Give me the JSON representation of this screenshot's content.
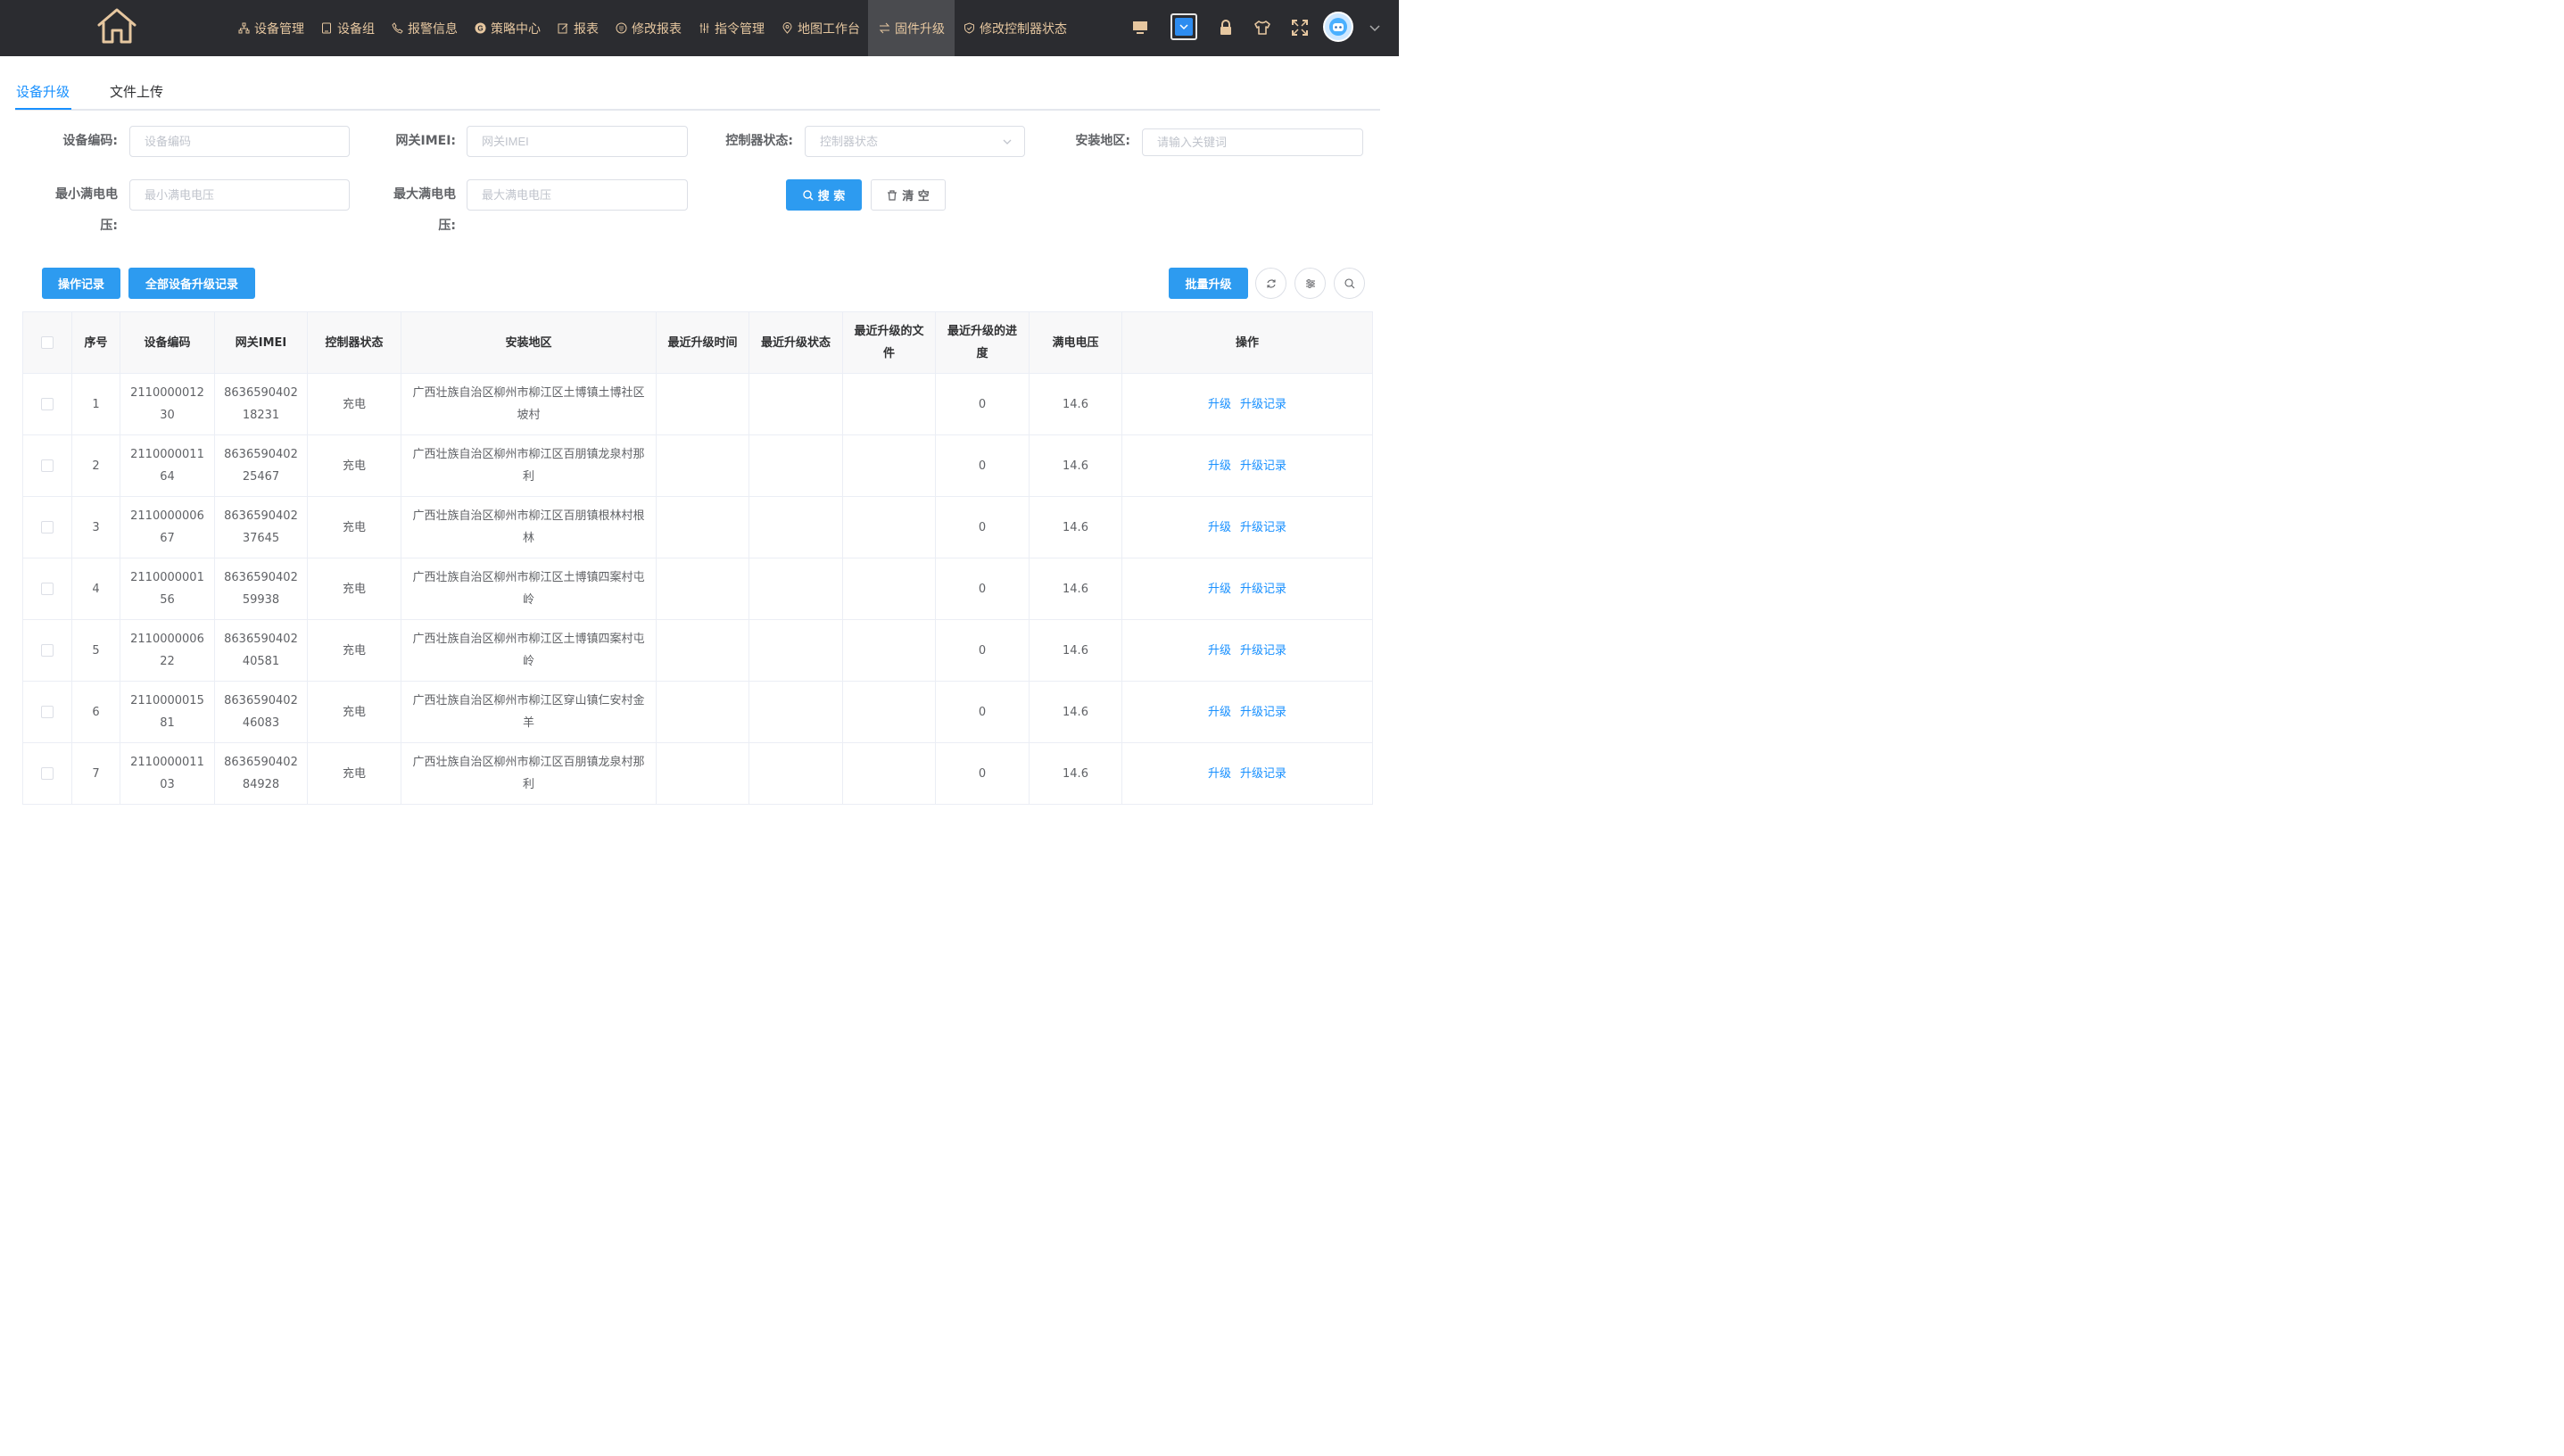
{
  "nav": {
    "items": [
      {
        "label": "设备管理",
        "icon": "sitemap-icon"
      },
      {
        "label": "设备组",
        "icon": "tablet-icon"
      },
      {
        "label": "报警信息",
        "icon": "phone-icon"
      },
      {
        "label": "策略中心",
        "icon": "strategy-icon"
      },
      {
        "label": "报表",
        "icon": "edit-icon"
      },
      {
        "label": "修改报表",
        "icon": "keyboard-icon"
      },
      {
        "label": "指令管理",
        "icon": "sliders-icon"
      },
      {
        "label": "地图工作台",
        "icon": "location-icon"
      },
      {
        "label": "固件升级",
        "icon": "switch-icon",
        "active": true
      },
      {
        "label": "修改控制器状态",
        "icon": "shield-icon"
      }
    ]
  },
  "tabs": [
    {
      "label": "设备升级",
      "active": true
    },
    {
      "label": "文件上传",
      "active": false
    }
  ],
  "filters": {
    "device_code": {
      "label": "设备编码:",
      "placeholder": "设备编码"
    },
    "gateway_imei": {
      "label": "网关IMEI:",
      "placeholder": "网关IMEI"
    },
    "controller_status": {
      "label": "控制器状态:",
      "placeholder": "控制器状态"
    },
    "install_area": {
      "label": "安装地区:",
      "placeholder": "请输入关键词"
    },
    "min_voltage": {
      "label_line1": "最小满电电",
      "label_line2": "压:",
      "placeholder": "最小满电电压"
    },
    "max_voltage": {
      "label_line1": "最大满电电",
      "label_line2": "压:",
      "placeholder": "最大满电电压"
    },
    "search_label": "搜 索",
    "clear_label": "清 空"
  },
  "toolbar": {
    "op_records": "操作记录",
    "all_upgrade_records": "全部设备升级记录",
    "batch_upgrade": "批量升级"
  },
  "table": {
    "headers": [
      "序号",
      "设备编码",
      "网关IMEI",
      "控制器状态",
      "安装地区",
      "最近升级时间",
      "最近升级状态",
      "最近升级的文件",
      "最近升级的进度",
      "满电电压",
      "操作"
    ],
    "upgrade_label": "升级",
    "records_label": "升级记录",
    "rows": [
      {
        "index": "1",
        "code": "211000001230",
        "imei": "863659040218231",
        "status": "充电",
        "area": "广西壮族自治区柳州市柳江区土博镇土博社区坡村",
        "time": "",
        "upstatus": "",
        "file": "",
        "progress": "0",
        "voltage": "14.6"
      },
      {
        "index": "2",
        "code": "2110000011 64",
        "imei": "863659040225467",
        "status": "充电",
        "area": "广西壮族自治区柳州市柳江区百朋镇龙泉村那利",
        "time": "",
        "upstatus": "",
        "file": "",
        "progress": "0",
        "voltage": "14.6"
      },
      {
        "index": "3",
        "code": "211000000667",
        "imei": "863659040237645",
        "status": "充电",
        "area": "广西壮族自治区柳州市柳江区百朋镇根林村根林",
        "time": "",
        "upstatus": "",
        "file": "",
        "progress": "0",
        "voltage": "14.6"
      },
      {
        "index": "4",
        "code": "211000000156",
        "imei": "863659040259938",
        "status": "充电",
        "area": "广西壮族自治区柳州市柳江区土博镇四案村屯岭",
        "time": "",
        "upstatus": "",
        "file": "",
        "progress": "0",
        "voltage": "14.6"
      },
      {
        "index": "5",
        "code": "211000000622",
        "imei": "863659040240581",
        "status": "充电",
        "area": "广西壮族自治区柳州市柳江区土博镇四案村屯岭",
        "time": "",
        "upstatus": "",
        "file": "",
        "progress": "0",
        "voltage": "14.6"
      },
      {
        "index": "6",
        "code": "211000001581",
        "imei": "863659040246083",
        "status": "充电",
        "area": "广西壮族自治区柳州市柳江区穿山镇仁安村金羊",
        "time": "",
        "upstatus": "",
        "file": "",
        "progress": "0",
        "voltage": "14.6"
      },
      {
        "index": "7",
        "code": "2110000011 03",
        "imei": "863659040284928",
        "status": "充电",
        "area": "广西壮族自治区柳州市柳江区百朋镇龙泉村那利",
        "time": "",
        "upstatus": "",
        "file": "",
        "progress": "0",
        "voltage": "14.6"
      }
    ]
  }
}
